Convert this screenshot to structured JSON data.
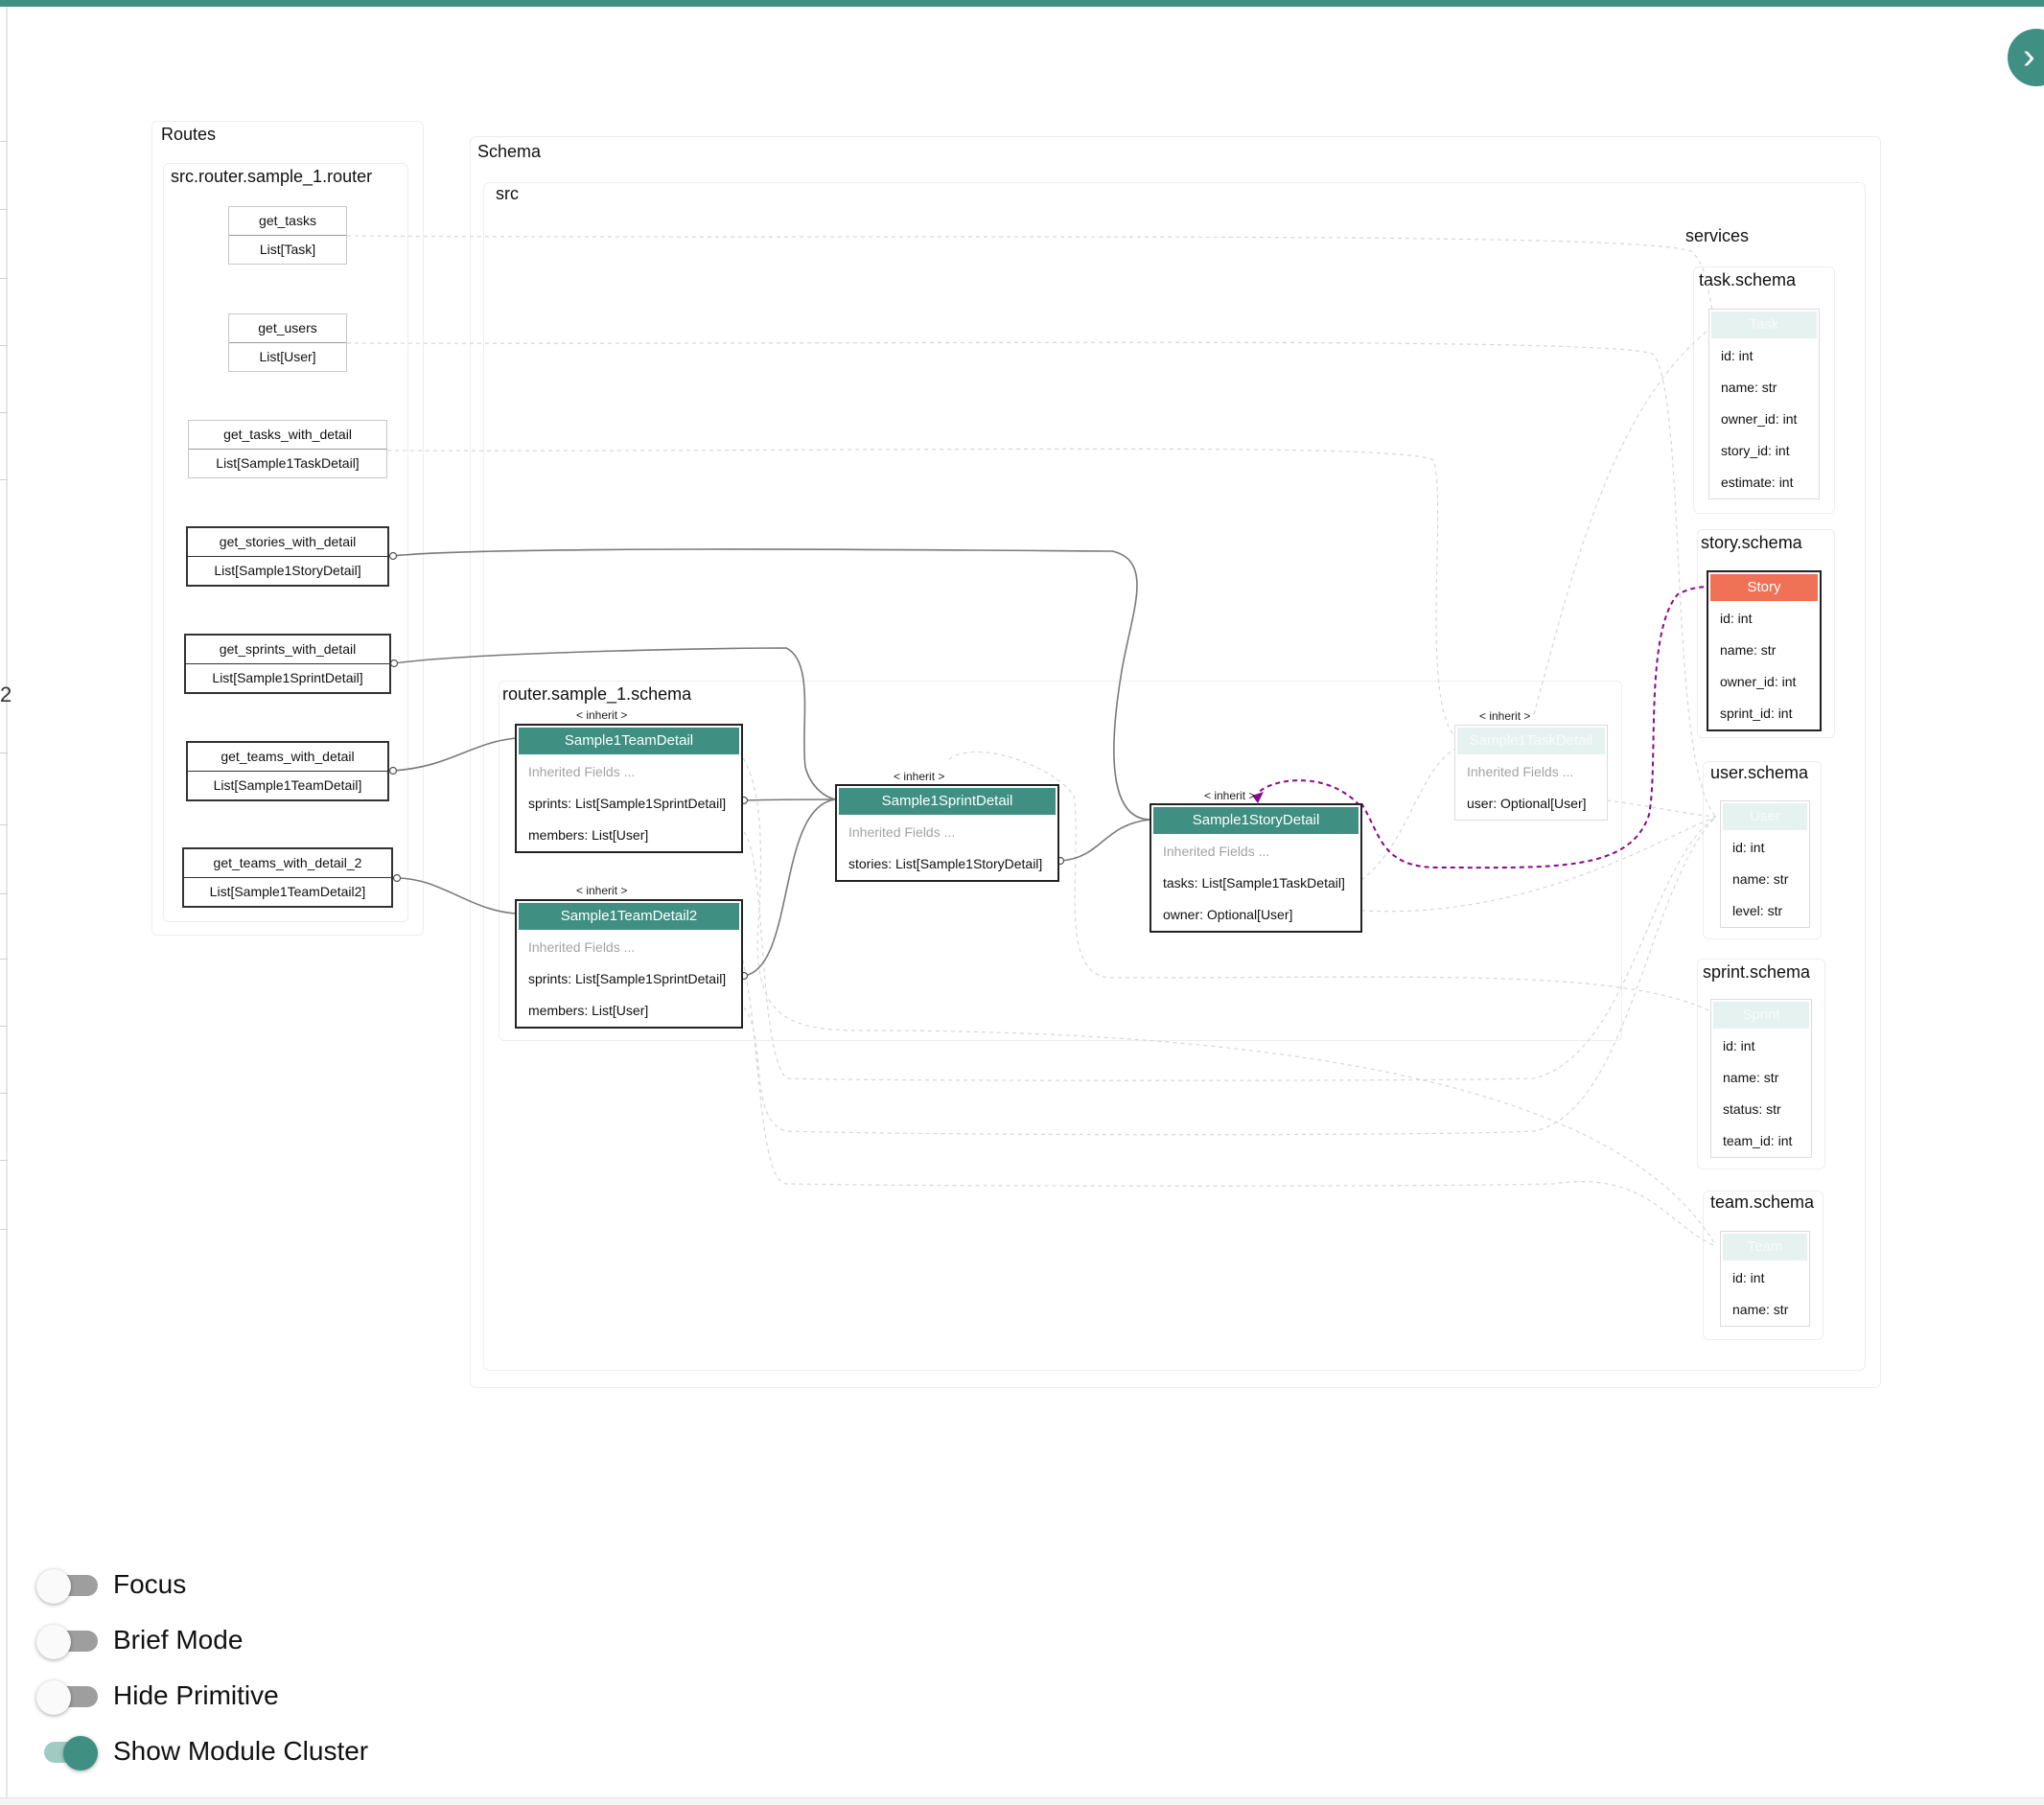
{
  "close_icon": "chevron-right-icon",
  "edge_glyph": "2",
  "clusters": {
    "routes": "Routes",
    "router_module": "src.router.sample_1.router",
    "schema": "Schema",
    "src": "src",
    "router_schema": "router.sample_1.schema",
    "services": "services",
    "task_schema": "task.schema",
    "story_schema": "story.schema",
    "user_schema": "user.schema",
    "sprint_schema": "sprint.schema",
    "team_schema": "team.schema"
  },
  "routes": [
    {
      "name": "get_tasks",
      "returns": "List[Task]"
    },
    {
      "name": "get_users",
      "returns": "List[User]"
    },
    {
      "name": "get_tasks_with_detail",
      "returns": "List[Sample1TaskDetail]"
    },
    {
      "name": "get_stories_with_detail",
      "returns": "List[Sample1StoryDetail]"
    },
    {
      "name": "get_sprints_with_detail",
      "returns": "List[Sample1SprintDetail]"
    },
    {
      "name": "get_teams_with_detail",
      "returns": "List[Sample1TeamDetail]"
    },
    {
      "name": "get_teams_with_detail_2",
      "returns": "List[Sample1TeamDetail2]"
    }
  ],
  "inherit_label": "< inherit >",
  "schemas": {
    "team_detail": {
      "title": "Sample1TeamDetail",
      "inherited": "Inherited Fields ...",
      "fields": [
        "sprints: List[Sample1SprintDetail]",
        "members: List[User]"
      ]
    },
    "team_detail2": {
      "title": "Sample1TeamDetail2",
      "inherited": "Inherited Fields ...",
      "fields": [
        "sprints: List[Sample1SprintDetail]",
        "members: List[User]"
      ]
    },
    "sprint_detail": {
      "title": "Sample1SprintDetail",
      "inherited": "Inherited Fields ...",
      "fields": [
        "stories: List[Sample1StoryDetail]"
      ]
    },
    "story_detail": {
      "title": "Sample1StoryDetail",
      "inherited": "Inherited Fields ...",
      "fields": [
        "tasks: List[Sample1TaskDetail]",
        "owner: Optional[User]"
      ]
    },
    "task_detail": {
      "title": "Sample1TaskDetail",
      "inherited": "Inherited Fields ...",
      "fields": [
        "user: Optional[User]"
      ]
    },
    "task": {
      "title": "Task",
      "fields": [
        "id: int",
        "name: str",
        "owner_id: int",
        "story_id: int",
        "estimate: int"
      ]
    },
    "story": {
      "title": "Story",
      "fields": [
        "id: int",
        "name: str",
        "owner_id: int",
        "sprint_id: int"
      ]
    },
    "user": {
      "title": "User",
      "fields": [
        "id: int",
        "name: str",
        "level: str"
      ]
    },
    "sprint": {
      "title": "Sprint",
      "fields": [
        "id: int",
        "name: str",
        "status: str",
        "team_id: int"
      ]
    },
    "team": {
      "title": "Team",
      "fields": [
        "id: int",
        "name: str"
      ]
    }
  },
  "controls": [
    {
      "label": "Focus",
      "on": false
    },
    {
      "label": "Brief Mode",
      "on": false
    },
    {
      "label": "Hide Primitive",
      "on": false
    },
    {
      "label": "Show Module Cluster",
      "on": true
    }
  ],
  "colors": {
    "accent": "#3f8f83",
    "story_header": "#f07156",
    "dependency_edge": "#8a0a8a"
  }
}
